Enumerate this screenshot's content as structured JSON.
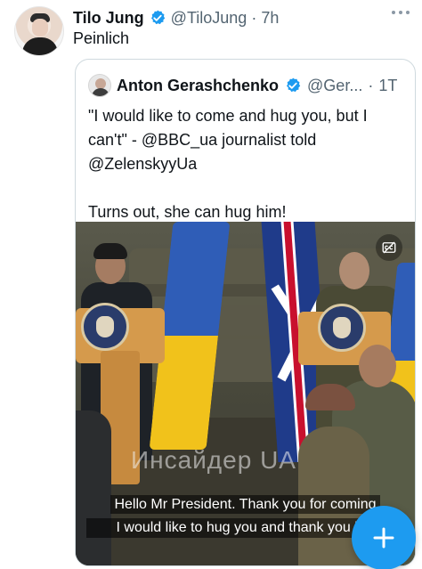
{
  "tweet": {
    "author_name": "Tilo Jung",
    "author_handle": "@TiloJung",
    "separator": "·",
    "time": "7h",
    "text": "Peinlich",
    "avatar_icon": "person-avatar",
    "verified_icon": "verified-badge-icon",
    "more_icon": "more-dots-icon"
  },
  "quoted_tweet": {
    "author_name": "Anton Gerashchenko",
    "author_handle": "@Ger...",
    "separator": "·",
    "time": "1T",
    "text": "\"I would like to come and hug you, but I can't\" - @BBC_ua journalist told @ZelenskyyUa\n\nTurns out, she can hug him!",
    "video": {
      "watermark": "Инсайдер UA",
      "subtitle_line1": "Hello Mr President. Thank you for coming",
      "subtitle_line2": "I would like to hug you and thank you but",
      "captions_icon": "captions-toggle-icon"
    }
  },
  "compose_button": {
    "icon": "plus-icon",
    "label": "+"
  },
  "colors": {
    "accent": "#1d9bf0",
    "muted_text": "#536471",
    "border": "#cfd9de"
  }
}
